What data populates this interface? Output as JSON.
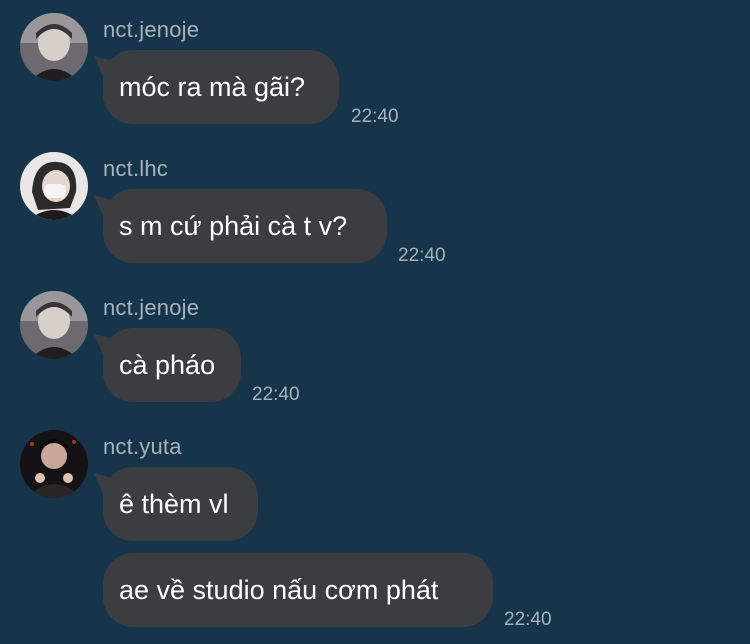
{
  "colors": {
    "background": "#16344a",
    "bubble": "#3b3d41",
    "meta_text": "#a7b2bc",
    "message_text": "#ffffff"
  },
  "messages": [
    {
      "sender": "nct.jenoje",
      "avatar_icon": "profile-photo-icon",
      "text": "móc ra mà gãi?",
      "time": "22:40"
    },
    {
      "sender": "nct.lhc",
      "avatar_icon": "profile-photo-icon",
      "text": "s m cứ phải cà t v?",
      "time": "22:40"
    },
    {
      "sender": "nct.jenoje",
      "avatar_icon": "profile-photo-icon",
      "text": "cà pháo",
      "time": "22:40"
    },
    {
      "sender": "nct.yuta",
      "avatar_icon": "profile-photo-icon",
      "text": "ê thèm vl",
      "time": ""
    },
    {
      "sender": "",
      "avatar_icon": "",
      "text": "ae về studio nấu cơm phát",
      "time": "22:40"
    }
  ]
}
